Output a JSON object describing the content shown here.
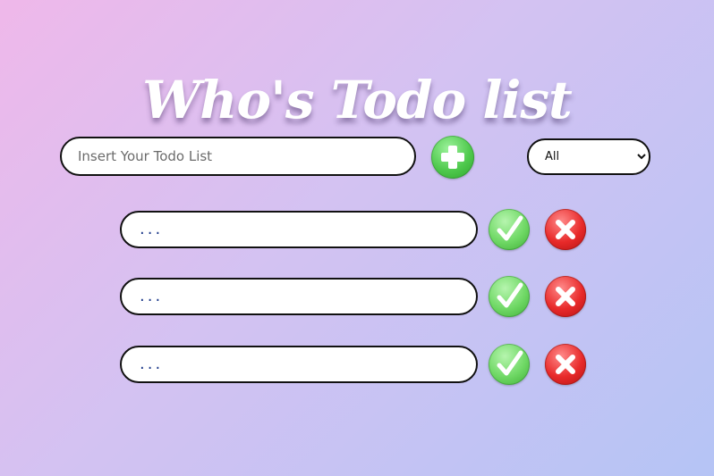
{
  "title": "Who's Todo list",
  "input": {
    "placeholder": "Insert Your Todo List",
    "value": ""
  },
  "add_button": {
    "icon": "plus-icon",
    "color": "#4fc94d"
  },
  "filter": {
    "selected": "All",
    "options": [
      "All"
    ]
  },
  "todos": [
    {
      "text": "...",
      "complete_icon": "check-icon",
      "delete_icon": "x-icon"
    },
    {
      "text": "...",
      "complete_icon": "check-icon",
      "delete_icon": "x-icon"
    },
    {
      "text": "...",
      "complete_icon": "check-icon",
      "delete_icon": "x-icon"
    }
  ],
  "colors": {
    "complete": "#6fd865",
    "delete": "#e82a2a",
    "background_start": "#efb8ea",
    "background_end": "#b5c4f5"
  }
}
